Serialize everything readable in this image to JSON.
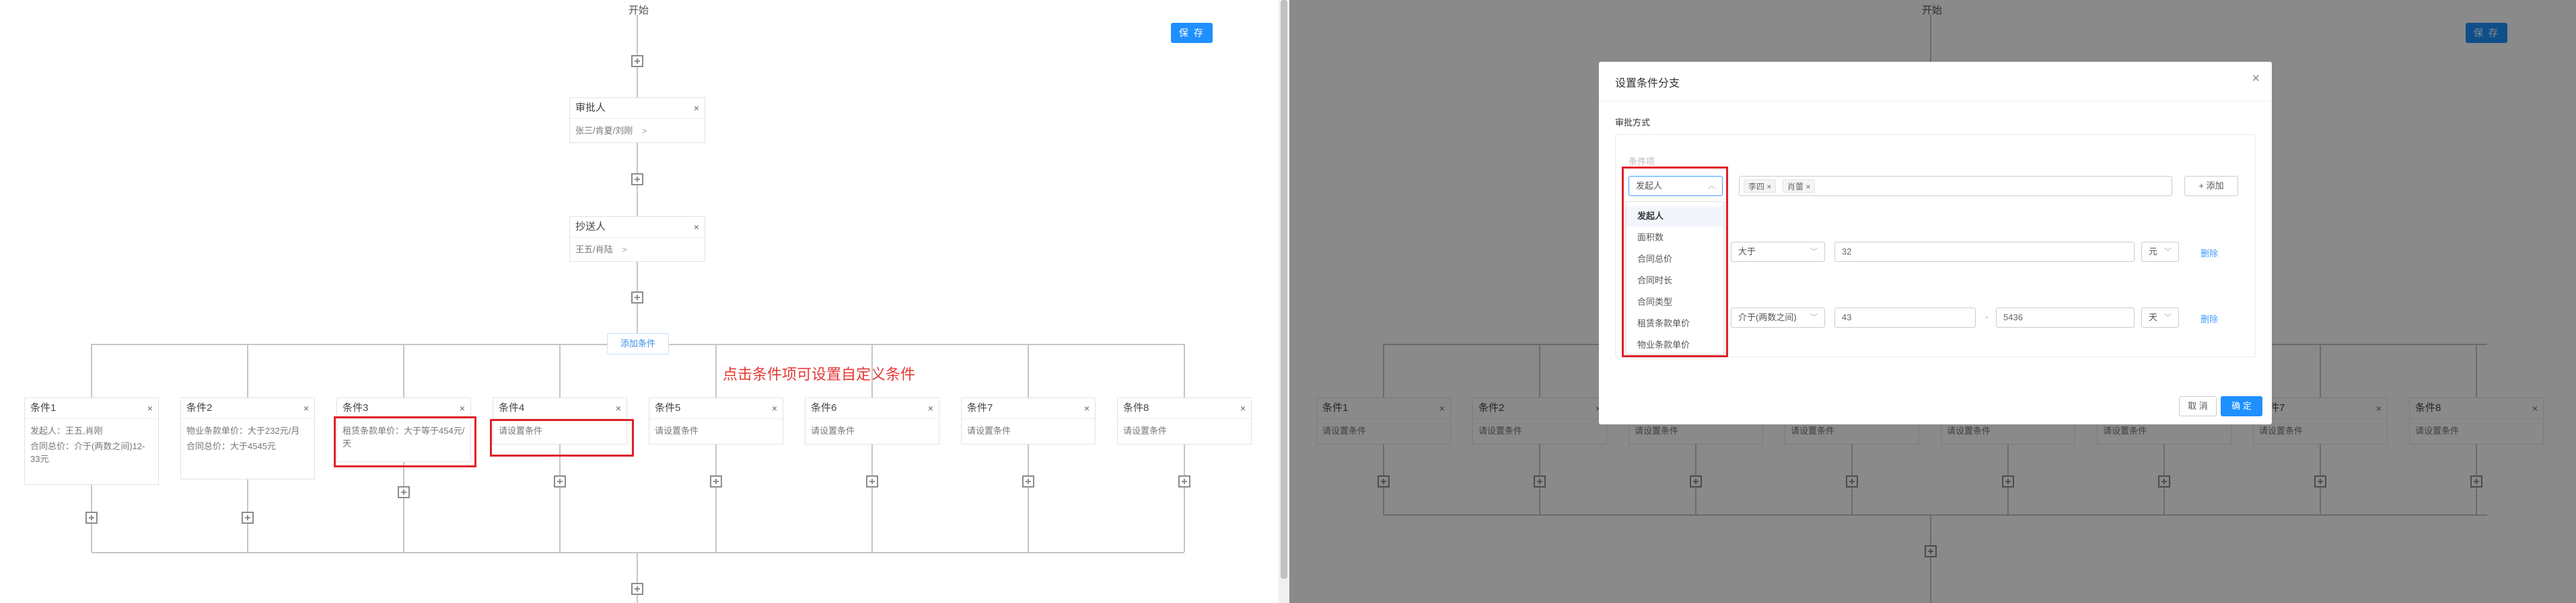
{
  "flow": {
    "start_label": "开始",
    "save_label": "保 存",
    "approver": {
      "title": "审批人",
      "value": "张三/肯夏/刘刚"
    },
    "cc": {
      "title": "抄送人",
      "value": "王五/肖陆"
    },
    "add_condition_label": "添加条件",
    "annotation": "点击条件项可设置自定义条件",
    "conditions": [
      {
        "title": "条件1",
        "lines": [
          "发起人：王五,肖刚",
          "合同总价：介于(两数之间)12-33元"
        ]
      },
      {
        "title": "条件2",
        "lines": [
          "物业条款单价：大于232元/月",
          "合同总价：大于4545元"
        ]
      },
      {
        "title": "条件3",
        "lines": [
          "租赁条款单价：大于等于454元/天"
        ]
      },
      {
        "title": "条件4",
        "lines": [
          "请设置条件"
        ]
      },
      {
        "title": "条件5",
        "lines": [
          "请设置条件"
        ]
      },
      {
        "title": "条件6",
        "lines": [
          "请设置条件"
        ]
      },
      {
        "title": "条件7",
        "lines": [
          "请设置条件"
        ]
      },
      {
        "title": "条件8",
        "lines": [
          "请设置条件"
        ]
      }
    ],
    "right_conditions": [
      {
        "title": "条件1",
        "lines": [
          "请设置条件"
        ]
      },
      {
        "title": "条件2",
        "lines": [
          "请设置条件"
        ]
      },
      {
        "title": "条件3",
        "lines": [
          "请设置条件"
        ]
      },
      {
        "title": "条件4",
        "lines": [
          "请设置条件"
        ]
      },
      {
        "title": "条件5",
        "lines": [
          "请设置条件"
        ]
      },
      {
        "title": "条件6",
        "lines": [
          "请设置条件"
        ]
      },
      {
        "title": "条件7",
        "lines": [
          "请设置条件"
        ]
      },
      {
        "title": "条件8",
        "lines": [
          "请设置条件"
        ]
      }
    ],
    "close_char": "×",
    "caret_char": ">"
  },
  "dialog": {
    "title": "设置条件分支",
    "close_char": "×",
    "section_label": "审批方式",
    "condition_label": "条件项",
    "row1": {
      "field": "发起人",
      "tags": [
        "李四",
        "肖蕾"
      ],
      "add_label": "+ 添加"
    },
    "row2": {
      "operator": "大于",
      "value": "32",
      "unit": "元",
      "delete_label": "删除"
    },
    "row3": {
      "operator": "介于(两数之间)",
      "value_min": "43",
      "value_max": "5436",
      "unit": "天",
      "delete_label": "删除",
      "separator": "-"
    },
    "dropdown_options": [
      "发起人",
      "面积数",
      "合同总价",
      "合同时长",
      "合同类型",
      "租赁条款单价",
      "物业条款单价"
    ],
    "cancel_label": "取 消",
    "ok_label": "确 定"
  },
  "colors": {
    "primary": "#1e90ff",
    "highlight_red": "#e0202a",
    "annotation_red": "#e53935"
  }
}
